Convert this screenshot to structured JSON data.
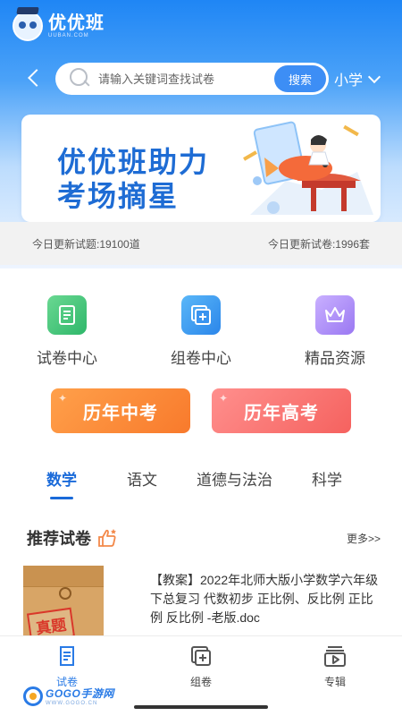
{
  "app": {
    "logo_text": "优优班",
    "logo_subtext": "UUBAN.COM"
  },
  "search": {
    "placeholder": "请输入关键词查找试卷",
    "button_label": "搜索",
    "grade": "小学"
  },
  "banner": {
    "line1": "优优班助力",
    "line2": "考场摘星"
  },
  "stats": {
    "questions": "今日更新试题:19100道",
    "papers": "今日更新试卷:1996套"
  },
  "quick_links": [
    {
      "label": "试卷中心",
      "icon": "scroll-icon"
    },
    {
      "label": "组卷中心",
      "icon": "add-paper-icon"
    },
    {
      "label": "精品资源",
      "icon": "crown-icon"
    }
  ],
  "exam_buttons": {
    "zhongkao": "历年中考",
    "gaokao": "历年高考"
  },
  "subject_tabs": [
    {
      "label": "数学",
      "active": true
    },
    {
      "label": "语文",
      "active": false
    },
    {
      "label": "道德与法治",
      "active": false
    },
    {
      "label": "科学",
      "active": false
    }
  ],
  "recommend": {
    "title": "推荐试卷",
    "more": "更多>>",
    "items": [
      {
        "thumb_stamp": "真题",
        "title": "【教案】2022年北师大版小学数学六年级下总复习 代数初步 正比例、反比例 正比例 反比例 -老版.doc"
      }
    ]
  },
  "bottom_nav": [
    {
      "label": "试卷",
      "icon": "paper-icon",
      "active": true
    },
    {
      "label": "组卷",
      "icon": "add-paper-icon",
      "active": false
    },
    {
      "label": "专辑",
      "icon": "album-icon",
      "active": false
    }
  ],
  "watermark": {
    "main": "GOGO手游网",
    "sub": "WWW.GOGO.CN"
  },
  "colors": {
    "primary": "#1a6ad9",
    "search_button": "#3d8ef5",
    "zhongkao": "#f87a2c",
    "gaokao": "#f5625f"
  }
}
